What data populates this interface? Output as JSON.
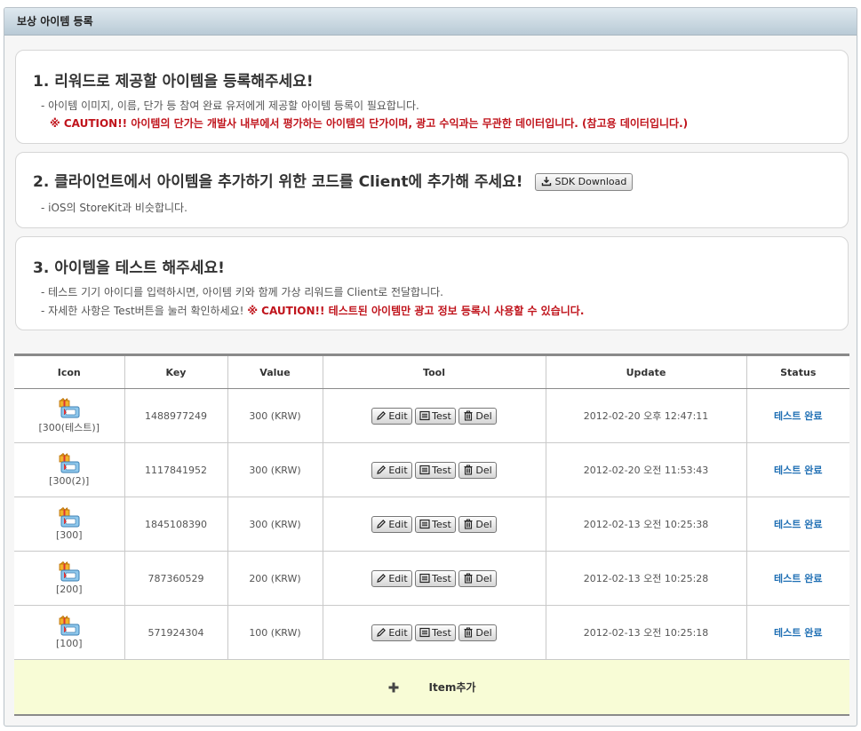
{
  "header": {
    "title": "보상 아이템 등록"
  },
  "steps": [
    {
      "title": "1. 리워드로 제공할 아이템을 등록해주세요!",
      "lines": [
        {
          "text": "- 아이템 이미지, 이름, 단가 등 참여 완료 유저에게 제공할 아이템 등록이 필요합니다."
        },
        {
          "caution": "※ CAUTION!! 아이템의 단가는 개발사 내부에서 평가하는 아이템의 단가이며, 광고 수익과는 무관한 데이터입니다. (참고용 데이터입니다.)"
        }
      ]
    },
    {
      "title": "2. 클라이언트에서 아이템을 추가하기 위한 코드를 Client에 추가해 주세요!",
      "button": "SDK Download",
      "lines": [
        {
          "text": "- iOS의 StoreKit과 비슷합니다."
        }
      ]
    },
    {
      "title": "3. 아이템을 테스트 해주세요!",
      "lines": [
        {
          "text": "- 테스트 기기 아이디를 입력하시면, 아이템 키와 함께 가상 리워드를 Client로 전달합니다."
        },
        {
          "text": "- 자세한 사항은 Test버튼을 눌러 확인하세요!",
          "caution": "※ CAUTION!! 테스트된 아이템만 광고 정보 등록시 사용할 수 있습니다."
        }
      ]
    }
  ],
  "table": {
    "columns": [
      "Icon",
      "Key",
      "Value",
      "Tool",
      "Update",
      "Status"
    ],
    "buttons": {
      "edit": "Edit",
      "test": "Test",
      "del": "Del"
    },
    "rows": [
      {
        "name": "[300(테스트)]",
        "key": "1488977249",
        "value": "300 (KRW)",
        "update": "2012-02-20 오후 12:47:11",
        "status": "테스트 완료"
      },
      {
        "name": "[300(2)]",
        "key": "1117841952",
        "value": "300 (KRW)",
        "update": "2012-02-20 오전 11:53:43",
        "status": "테스트 완료"
      },
      {
        "name": "[300]",
        "key": "1845108390",
        "value": "300 (KRW)",
        "update": "2012-02-13 오전 10:25:38",
        "status": "테스트 완료"
      },
      {
        "name": "[200]",
        "key": "787360529",
        "value": "200 (KRW)",
        "update": "2012-02-13 오전 10:25:28",
        "status": "테스트 완료"
      },
      {
        "name": "[100]",
        "key": "571924304",
        "value": "100 (KRW)",
        "update": "2012-02-13 오전 10:25:18",
        "status": "테스트 완료"
      }
    ],
    "add_label": "Item추가"
  },
  "colors": {
    "caution": "#c0141c",
    "status": "#1f6fb4",
    "add_row_bg": "#f8fcd6"
  },
  "icons": {
    "row_icon": "gift-box-icon",
    "edit": "pencil-icon",
    "test": "list-icon",
    "del": "trash-icon",
    "add": "plus-icon",
    "sdk": "download-icon"
  }
}
